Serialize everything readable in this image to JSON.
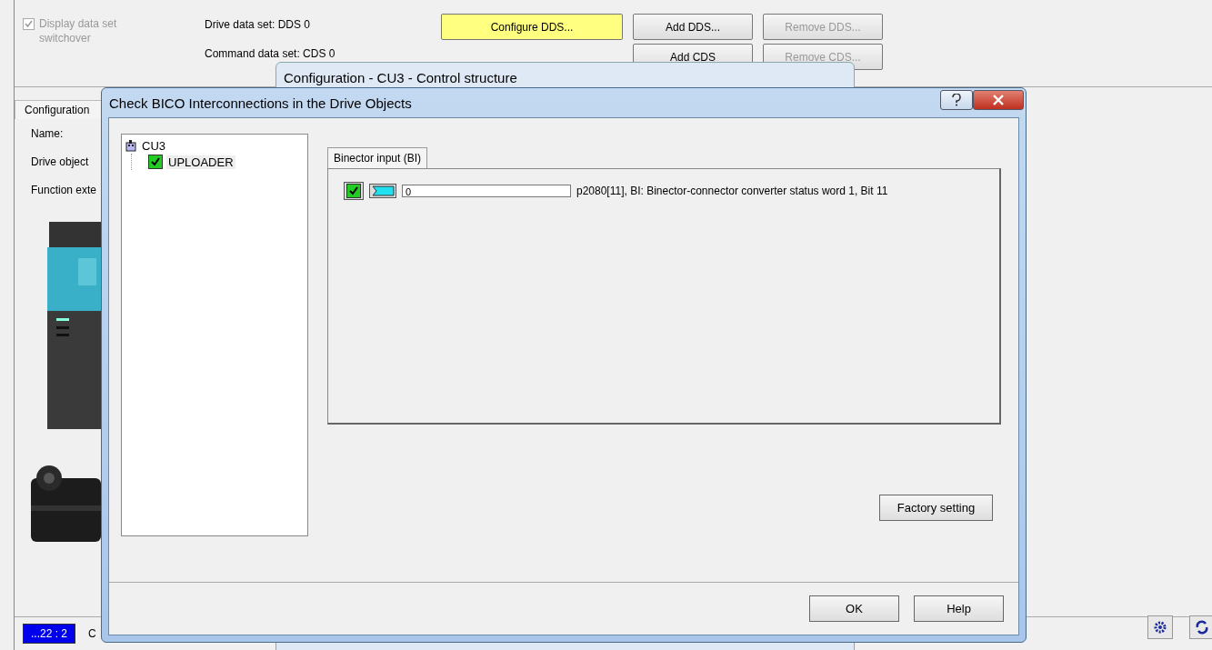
{
  "app": {
    "switchover": {
      "label": "Display data set switchover",
      "checked": true,
      "disabled": true
    },
    "data_sets": [
      "Drive data set: DDS 0",
      "Command data set: CDS 0"
    ],
    "buttons": [
      {
        "label": "Configure DDS...",
        "kind": "highlight",
        "disabled": false
      },
      {
        "label": "Add DDS...",
        "kind": "normal",
        "disabled": false
      },
      {
        "label": "Remove DDS...",
        "kind": "normal",
        "disabled": true
      },
      {
        "label": "Add CDS",
        "kind": "normal",
        "disabled": false
      },
      {
        "label": "Remove CDS...",
        "kind": "normal",
        "disabled": true
      }
    ],
    "side_tab": {
      "label": "Configuration",
      "selected": true
    },
    "fields": [
      "Name:",
      "Drive object",
      "Function exte"
    ],
    "status": {
      "badge": "...22 : 2",
      "text": "C"
    }
  },
  "background_window": {
    "title": "Configuration - CU3 - Control structure"
  },
  "dialog": {
    "title": "Check BICO Interconnections in the Drive Objects",
    "tree": [
      {
        "label": "CU3",
        "children": [
          {
            "label": "UPLOADER",
            "checked": true
          }
        ]
      }
    ],
    "tab": {
      "label": "Binector input (BI)",
      "selected": true
    },
    "rows": [
      {
        "checked": true,
        "value": "0",
        "description": "p2080[11], BI: Binector-connector converter status word 1, Bit 11"
      }
    ],
    "factory_button": "Factory setting",
    "buttons": [
      "OK",
      "Help"
    ]
  }
}
